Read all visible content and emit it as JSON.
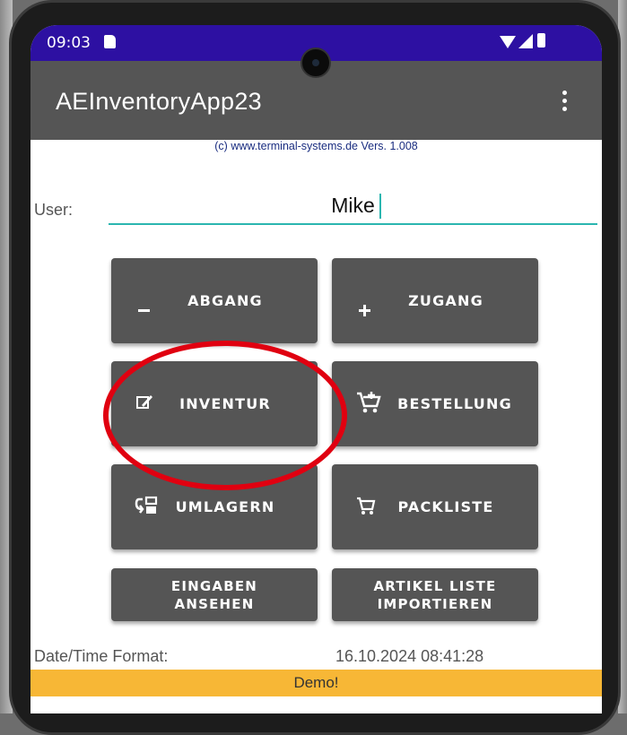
{
  "status_bar": {
    "time": "09:03",
    "icons": [
      "sd-card-icon",
      "wifi-icon",
      "signal-icon",
      "battery-icon"
    ]
  },
  "app_bar": {
    "title": "AEInventoryApp23",
    "menu_icon": "overflow-menu-icon"
  },
  "copyright": "(c) www.terminal-systems.de Vers. 1.008",
  "user": {
    "label": "User:",
    "value": "Mike"
  },
  "buttons": {
    "abgang": {
      "label": "ABGANG",
      "icon": "minus-circle-icon"
    },
    "zugang": {
      "label": "ZUGANG",
      "icon": "plus-circle-icon"
    },
    "inventur": {
      "label": "INVENTUR",
      "icon": "edit-icon"
    },
    "bestellung": {
      "label": "BESTELLUNG",
      "icon": "cart-plus-icon"
    },
    "umlagern": {
      "label": "UMLAGERN",
      "icon": "transfer-icon"
    },
    "packliste": {
      "label": "PACKLISTE",
      "icon": "cart-icon"
    },
    "eingaben": {
      "line1": "EINGABEN",
      "line2": "ANSEHEN"
    },
    "artikel": {
      "line1": "ARTIKEL LISTE",
      "line2": "IMPORTIEREN"
    }
  },
  "footer": {
    "datetime_label": "Date/Time Format:",
    "datetime_value": "16.10.2024 08:41:28",
    "demo": "Demo!"
  },
  "colors": {
    "status_bar": "#2d10a2",
    "app_bar": "#555555",
    "button": "#555555",
    "accent_underline": "#2bb6b0",
    "demo_bar": "#f7b736",
    "annotation": "#e00010"
  }
}
